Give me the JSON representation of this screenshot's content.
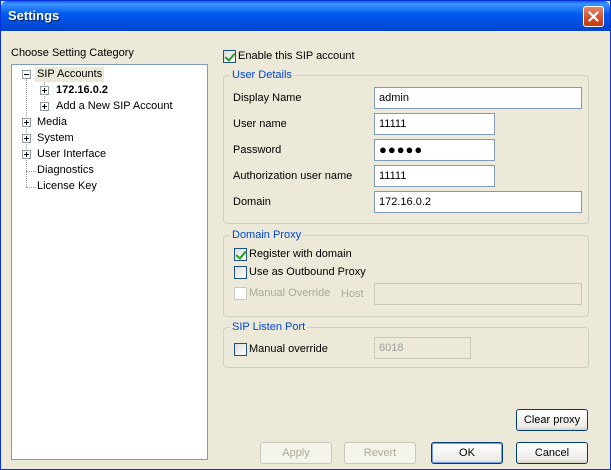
{
  "window": {
    "title": "Settings"
  },
  "left": {
    "heading": "Choose Setting Category",
    "tree": [
      {
        "label": "SIP Accounts"
      },
      {
        "label": "172.16.0.2"
      },
      {
        "label": "Add a New SIP Account"
      },
      {
        "label": "Media"
      },
      {
        "label": "System"
      },
      {
        "label": "User Interface"
      },
      {
        "label": "Diagnostics"
      },
      {
        "label": "License Key"
      }
    ]
  },
  "enable": {
    "label": "Enable this SIP account",
    "checked": true
  },
  "user_details": {
    "title": "User Details",
    "display_name": {
      "label": "Display Name",
      "value": "admin"
    },
    "user_name": {
      "label": "User name",
      "value": "11111"
    },
    "password": {
      "label": "Password",
      "value": "●●●●●"
    },
    "auth_user": {
      "label": "Authorization user name",
      "value": "11111"
    },
    "domain": {
      "label": "Domain",
      "value": "172.16.0.2"
    }
  },
  "domain_proxy": {
    "title": "Domain Proxy",
    "register": {
      "label": "Register with domain",
      "checked": true
    },
    "outbound": {
      "label": "Use as Outbound Proxy",
      "checked": false
    },
    "manual": {
      "label": "Manual Override",
      "checked": false
    },
    "host_label": "Host",
    "host_value": ""
  },
  "listen_port": {
    "title": "SIP Listen Port",
    "manual": {
      "label": "Manual override",
      "checked": false
    },
    "port_value": "6018"
  },
  "buttons": {
    "clear_proxy": "Clear proxy",
    "apply": "Apply",
    "revert": "Revert",
    "ok": "OK",
    "cancel": "Cancel"
  }
}
